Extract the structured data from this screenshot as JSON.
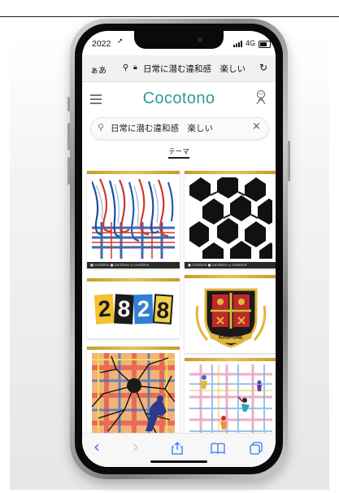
{
  "status_bar": {
    "time": "2022",
    "network": "4G"
  },
  "address_bar": {
    "aa_label": "ぁあ",
    "url": "日常に潜む違和感　楽しい"
  },
  "site": {
    "logo": "Cocotono"
  },
  "search": {
    "value": "日常に潜む違和感　楽しい"
  },
  "section": {
    "theme_label": "テーマ"
  },
  "cards": [
    {
      "name": "tartan-melt-artwork",
      "footer": "■ cocotono  ■ cocotono  ◎ cocotono"
    },
    {
      "name": "houndstooth-artwork",
      "footer": "■ cocotono  ■ cocotono  ◎ cocotono"
    },
    {
      "name": "numbers-2828-artwork",
      "footer": ""
    },
    {
      "name": "crest-emblem-artwork",
      "footer": ""
    },
    {
      "name": "cracked-plaid-artwork",
      "footer": ""
    },
    {
      "name": "plaid-figures-artwork",
      "footer": ""
    }
  ],
  "crest": {
    "banner": "RANPONE"
  },
  "numbers_art": {
    "digits": [
      "2",
      "8",
      "2",
      "8"
    ]
  },
  "toolbar": {
    "back": "‹",
    "forward": "›"
  },
  "colors": {
    "logo": "#2e9c95",
    "safari_blue": "#3478f6",
    "gold": "#d4ab3c",
    "frame": "#9a9a9a"
  }
}
